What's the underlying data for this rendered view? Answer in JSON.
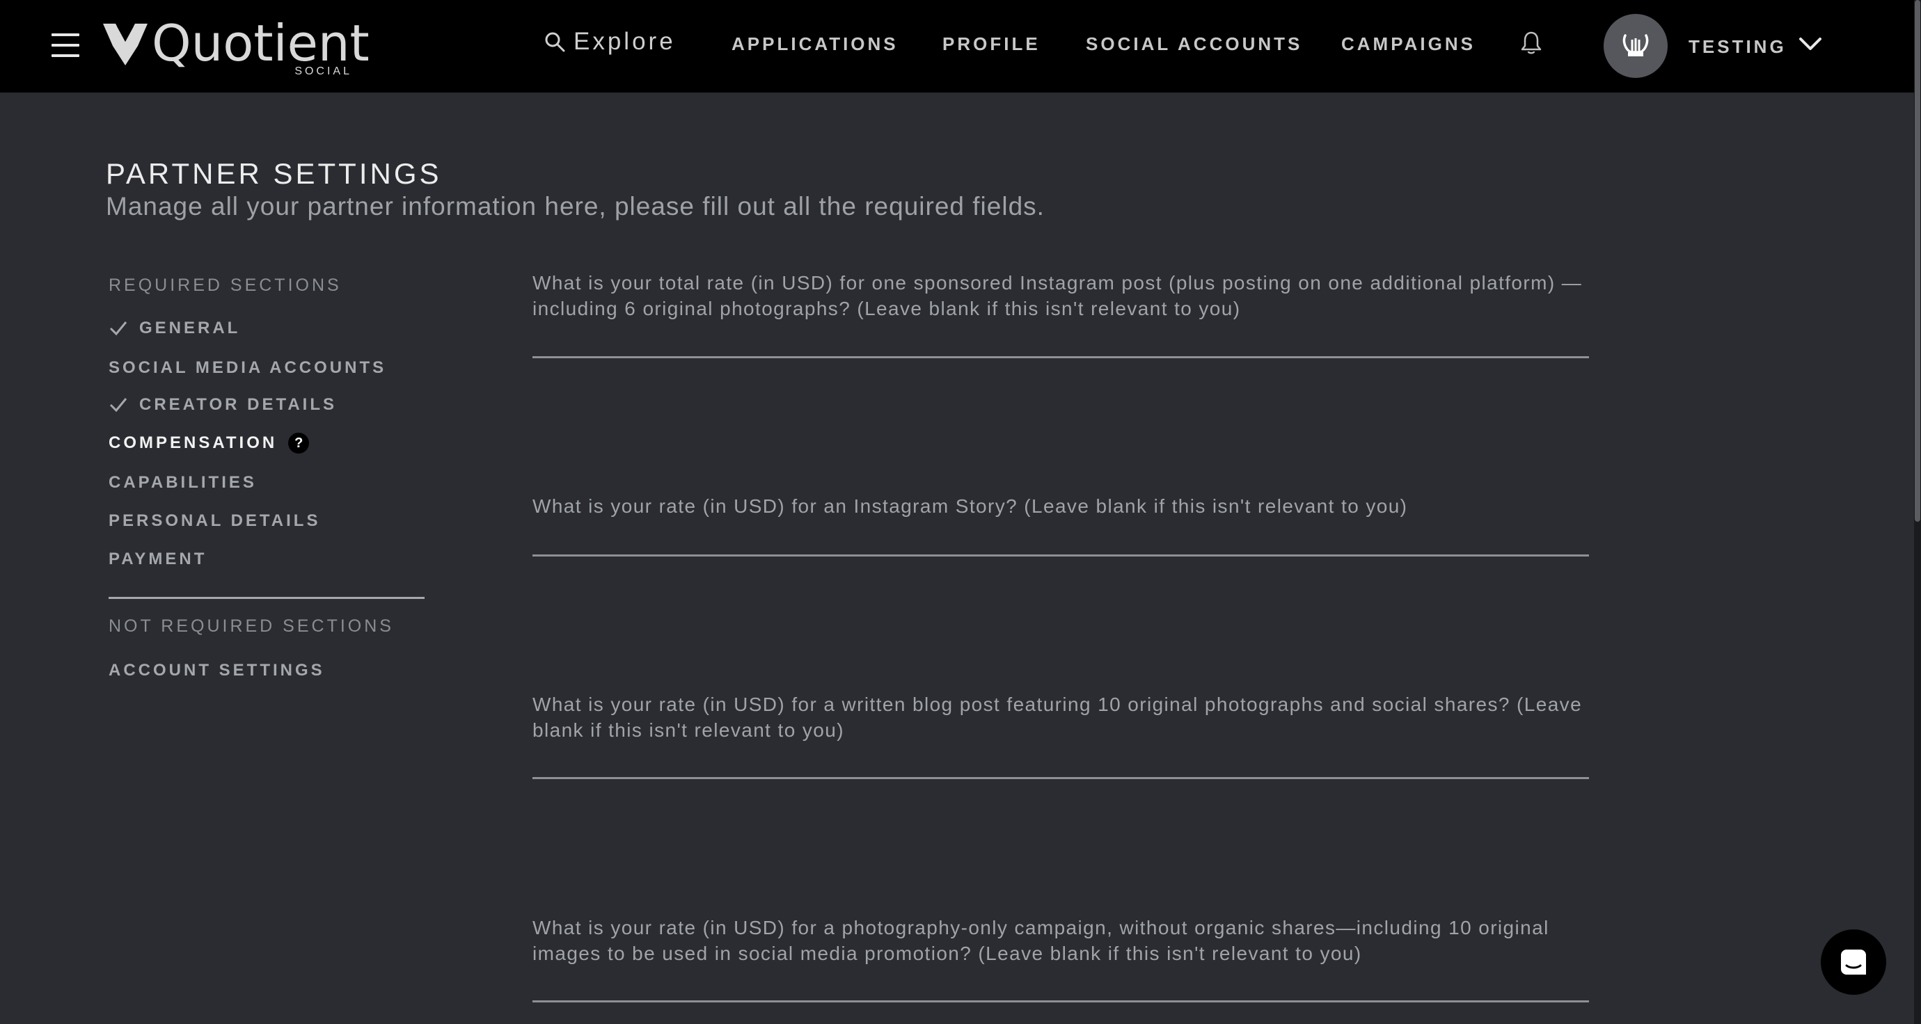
{
  "nav": {
    "brand": "Quotient",
    "brand_sub": "SOCIAL",
    "explore": "Explore",
    "links": [
      "APPLICATIONS",
      "PROFILE",
      "SOCIAL ACCOUNTS",
      "CAMPAIGNS"
    ],
    "user": "TESTING",
    "icons": [
      "menu-icon",
      "search-icon",
      "bell-icon",
      "lyre-avatar-icon",
      "chevron-down-icon"
    ]
  },
  "header": {
    "title": "PARTNER SETTINGS",
    "subtitle": "Manage all your partner information here, please fill out all the required fields."
  },
  "sidebar": {
    "required_heading": "REQUIRED SECTIONS",
    "required": [
      {
        "label": "GENERAL",
        "done": true
      },
      {
        "label": "SOCIAL MEDIA ACCOUNTS",
        "done": false
      },
      {
        "label": "CREATOR DETAILS",
        "done": true
      },
      {
        "label": "COMPENSATION",
        "active": true,
        "help": "?"
      },
      {
        "label": "CAPABILITIES",
        "done": false
      },
      {
        "label": "PERSONAL DETAILS",
        "done": false
      },
      {
        "label": "PAYMENT",
        "done": false
      }
    ],
    "optional_heading": "NOT REQUIRED SECTIONS",
    "optional": [
      {
        "label": "ACCOUNT SETTINGS"
      }
    ]
  },
  "questions": [
    {
      "text": "What is your total rate (in USD) for one sponsored Instagram post (plus posting on one additional platform) — including 6 original photographs? (Leave blank if this isn't relevant to you)",
      "value": ""
    },
    {
      "text": "What is your rate (in USD) for an Instagram Story? (Leave blank if this isn't relevant to you)",
      "value": ""
    },
    {
      "text": "What is your rate (in USD) for a written blog post featuring 10 original photographs and social shares? (Leave blank if this isn't relevant to you)",
      "value": ""
    },
    {
      "text": "What is your rate (in USD) for a photography-only campaign, without organic shares—including 10 original images to be used in social media promotion? (Leave blank if this isn't relevant to you)",
      "value": ""
    }
  ],
  "colors": {
    "background": "#2a2c31",
    "topbar": "#000000",
    "text_muted": "#a0a3a8",
    "text_active": "#f2f2f2"
  }
}
